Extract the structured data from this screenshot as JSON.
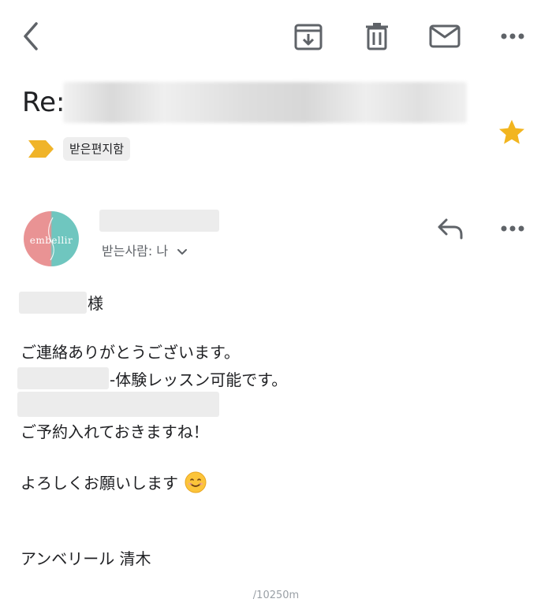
{
  "toolbar": {
    "back_icon": "chevron-left-icon",
    "archive_icon": "archive-icon",
    "delete_icon": "trash-icon",
    "mark_unread_icon": "envelope-icon",
    "more_icon": "more-horizontal-icon"
  },
  "subject": {
    "prefix": "Re:",
    "starred": true
  },
  "label": {
    "name": "받은편지함",
    "marker_color": "#f0b429"
  },
  "message": {
    "avatar_text": "embellir",
    "recipient_label": "받는사람: 나",
    "body": {
      "greeting_suffix": "様",
      "line1": "ご連絡ありがとうございます。",
      "line2": "-体験レッスン可能です。",
      "line3": "ご予約入れておきますね！",
      "line4": "よろしくお願いします",
      "signature": "アンベリール 清木"
    }
  },
  "footer": {
    "text": "/10250m"
  },
  "colors": {
    "star": "#f2b51f",
    "icon": "#5f6368"
  }
}
